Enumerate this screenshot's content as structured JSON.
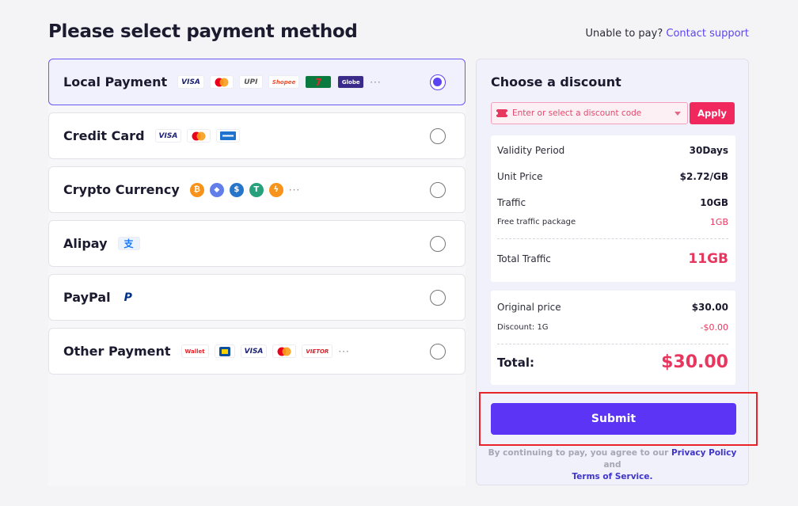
{
  "header": {
    "title": "Please select payment method",
    "help_text": "Unable to pay?",
    "help_link": "Contact support"
  },
  "methods": [
    {
      "label": "Local Payment",
      "selected": true,
      "logos": [
        "VISA",
        "mastercard",
        "UPI",
        "Shopee",
        "7-Eleven",
        "Globe"
      ]
    },
    {
      "label": "Credit Card",
      "selected": false,
      "logos": [
        "VISA",
        "mastercard",
        "AMEX"
      ]
    },
    {
      "label": "Crypto Currency",
      "selected": false,
      "logos": [
        "bitcoin",
        "ethereum",
        "usdc",
        "tether",
        "lightning"
      ]
    },
    {
      "label": "Alipay",
      "selected": false,
      "logos": [
        "alipay"
      ]
    },
    {
      "label": "PayPal",
      "selected": false,
      "logos": [
        "paypal"
      ]
    },
    {
      "label": "Other Payment",
      "selected": false,
      "logos": [
        "Wallet",
        "Touch n Go",
        "VISA",
        "mastercard",
        "Vietor"
      ]
    }
  ],
  "logo_text": {
    "visa": "VISA",
    "upi": "UPI",
    "shopee": "Shopee",
    "seven": "7",
    "globe": "Globe",
    "wallet": "Wallet",
    "vietor": "VIETOR",
    "more": "···",
    "alipay": "支",
    "paypal": "P",
    "btc": "₿",
    "eth": "◆",
    "usdc": "$",
    "usdt": "T",
    "bolt": "ϟ"
  },
  "discount": {
    "title": "Choose a discount",
    "code_placeholder": "Enter or select a discount code",
    "apply_label": "Apply"
  },
  "summary": {
    "validity_label": "Validity Period",
    "validity_value": "30Days",
    "unit_price_label": "Unit Price",
    "unit_price_value": "$2.72/GB",
    "traffic_label": "Traffic",
    "traffic_value": "10GB",
    "free_label": "Free traffic package",
    "free_value": "1GB",
    "total_traffic_label": "Total Traffic",
    "total_traffic_value": "11GB"
  },
  "price": {
    "original_label": "Original price",
    "original_value": "$30.00",
    "discount_label": "Discount: 1G",
    "discount_value": "-$0.00",
    "total_label": "Total:",
    "total_value": "$30.00"
  },
  "submit_label": "Submit",
  "terms": {
    "prefix": "By continuing to pay, you agree to our",
    "privacy": "Privacy Policy",
    "and": "and",
    "tos": "Terms of Service."
  },
  "colors": {
    "accent": "#5b34f5",
    "pink": "#e8375e",
    "highlight": "#e8232a"
  }
}
